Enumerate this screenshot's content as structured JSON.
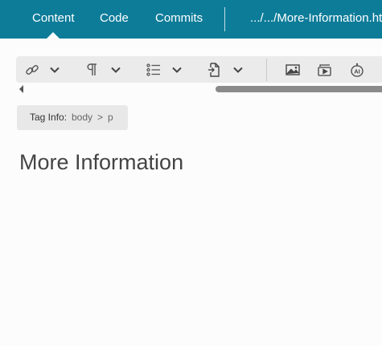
{
  "nav": {
    "tabs": [
      {
        "label": "Content",
        "active": true
      },
      {
        "label": "Code",
        "active": false
      },
      {
        "label": "Commits",
        "active": false
      }
    ],
    "file_path": ".../.../More-Information.html"
  },
  "toolbar": {
    "buttons": [
      {
        "icon": "link-icon"
      },
      {
        "icon": "chevron-down-icon"
      },
      {
        "icon": "pilcrow-icon"
      },
      {
        "icon": "chevron-down-icon"
      },
      {
        "icon": "list-icon"
      },
      {
        "icon": "chevron-down-icon"
      },
      {
        "icon": "insert-file-icon"
      },
      {
        "icon": "chevron-down-icon"
      },
      {
        "icon": "image-icon"
      },
      {
        "icon": "media-icon"
      },
      {
        "icon": "ai-icon"
      }
    ],
    "ai_icon_text": "AI"
  },
  "tag_info": {
    "label": "Tag Info:",
    "path": [
      "body",
      "p"
    ],
    "separator": ">"
  },
  "content": {
    "heading": "More Information"
  },
  "colors": {
    "header_bg": "#0d7c99",
    "toolbar_bg": "#ebebeb",
    "page_bg": "#fcfcfc"
  }
}
